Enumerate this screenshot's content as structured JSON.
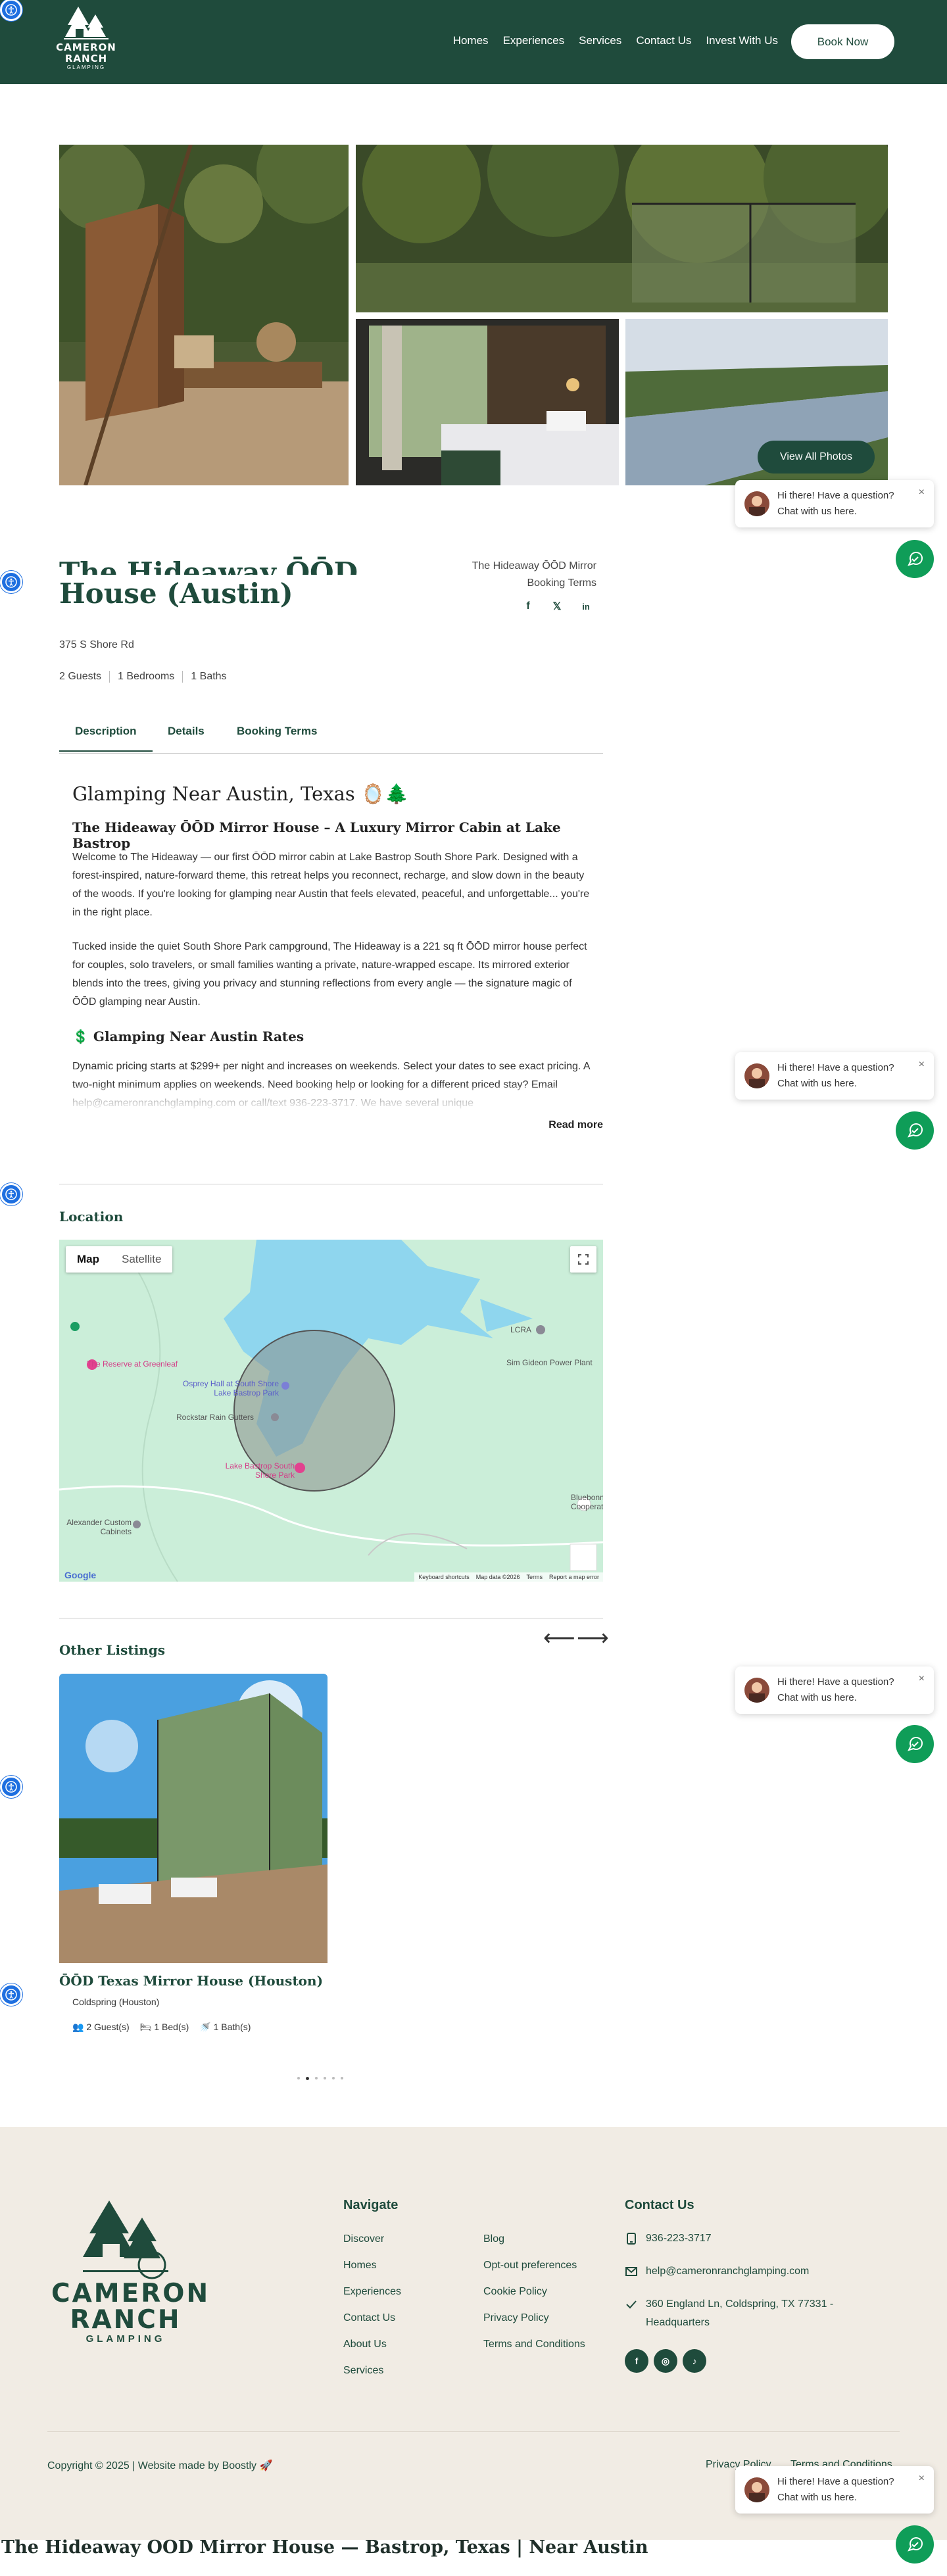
{
  "header": {
    "logo": {
      "line1": "CAMERON",
      "line2": "RANCH",
      "line3": "GLAMPING"
    },
    "nav": [
      "Homes",
      "Experiences",
      "Services",
      "Contact Us",
      "Invest With Us"
    ],
    "book_label": "Book Now"
  },
  "gallery": {
    "view_all_label": "View All Photos"
  },
  "chat": {
    "line1": "Hi there! Have a question?",
    "line2": "Chat with us here.",
    "close": "×"
  },
  "listing": {
    "title_line1": "The Hideaway ŌŌD Mirror",
    "title_line2": "House (Austin)",
    "side_title": "The Hideaway ŌŌD Mirror",
    "booking_terms_link": "Booking Terms",
    "social": [
      "f",
      "𝕏",
      "in"
    ],
    "address": "375 S Shore Rd",
    "stats": [
      "2 Guests",
      "1 Bedrooms",
      "1 Baths"
    ],
    "tabs": [
      "Description",
      "Details",
      "Booking Terms"
    ]
  },
  "description": {
    "heading": "Glamping Near Austin, Texas 🪞🌲",
    "subheading": "The Hideaway ŌŌD Mirror House – A Luxury Mirror Cabin at Lake Bastrop",
    "p1": "Welcome to The Hideaway — our first ŌŌD mirror cabin at Lake Bastrop South Shore Park. Designed with a forest-inspired, nature-forward theme, this retreat helps you reconnect, recharge, and slow down in the beauty of the woods. If you're looking for glamping near Austin that feels elevated, peaceful, and unforgettable... you're in the right place.",
    "p2": "Tucked inside the quiet South Shore Park campground, The Hideaway is a 221 sq ft ŌŌD mirror house perfect for couples, solo travelers, or small families wanting a private, nature-wrapped escape. Its mirrored exterior blends into the trees, giving you privacy and stunning reflections from every angle — the signature magic of ŌŌD glamping near Austin.",
    "rates_heading": "💲 Glamping Near Austin Rates",
    "p3": "Dynamic pricing starts at $299+ per night and increases on weekends. Select your dates to see exact pricing. A two-night minimum applies on weekends. Need booking help or looking for a different priced stay? Email help@cameronranchglamping.com or call/text 936-223-3717. We have several unique",
    "read_more": "Read more"
  },
  "location": {
    "heading": "Location",
    "map_tab": "Map",
    "satellite_tab": "Satellite",
    "places": [
      "The Reserve at Greenleaf",
      "Osprey Hall at South Shore Lake Bastrop Park",
      "Rockstar Rain Gutters",
      "Lake Bastrop South Shore Park",
      "Alexander Custom Cabinets",
      "LCRA",
      "Sim Gideon Power Plant",
      "Bluebonnet Cooperative"
    ],
    "map_footer": [
      "Keyboard shortcuts",
      "Map data ©2026",
      "Terms",
      "Report a map error"
    ],
    "google": "Google"
  },
  "other_listings": {
    "heading": "Other Listings",
    "prev": "⟵",
    "next": "⟶",
    "card": {
      "title": "ŌŌD Texas Mirror House (Houston)",
      "location": "Coldspring (Houston)",
      "guests": "2 Guest(s)",
      "beds": "1 Bed(s)",
      "baths": "1 Bath(s)"
    }
  },
  "footer": {
    "logo": {
      "line1": "CAMERON",
      "line2": "RANCH",
      "line3": "GLAMPING"
    },
    "navigate_heading": "Navigate",
    "nav_col1": [
      "Discover",
      "Homes",
      "Experiences",
      "Contact Us",
      "About Us",
      "Services"
    ],
    "nav_col2": [
      "Blog",
      "Opt-out preferences",
      "Cookie Policy",
      "Privacy Policy",
      "Terms and Conditions"
    ],
    "contact_heading": "Contact Us",
    "phone": "936-223-3717",
    "email": "help@cameronranchglamping.com",
    "address_line1": "360 England Ln, Coldspring, TX 77331 -",
    "address_line2": "Headquarters",
    "social": [
      "f",
      "◎",
      "♪"
    ],
    "copyright": "Copyright © 2025 | Website made by Boostly 🚀",
    "legal": [
      "Privacy Policy",
      "Terms and Conditions"
    ]
  },
  "page_title": "The Hideaway OOD Mirror House — Bastrop, Texas | Near Austin",
  "colors": {
    "brand": "#1f4b3c",
    "chat_green": "#0f9d58",
    "footer_bg": "#f1ece4",
    "a11y_blue": "#1e6fe0"
  }
}
